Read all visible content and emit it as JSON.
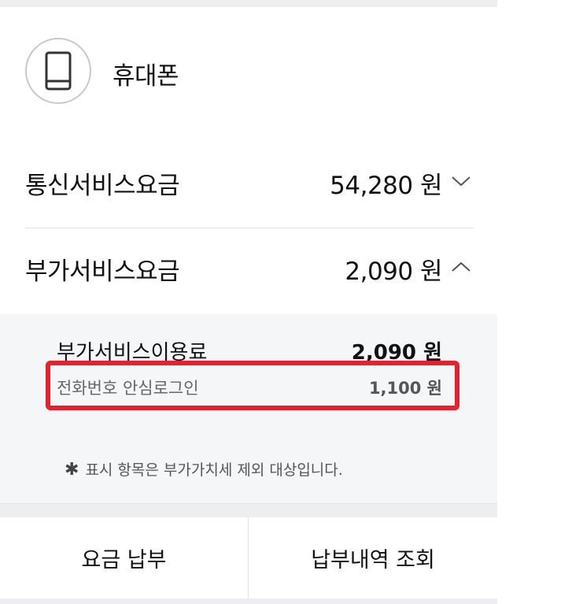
{
  "device": {
    "name": "휴대폰",
    "icon": "smartphone-icon"
  },
  "fees": [
    {
      "label": "통신서비스요금",
      "amount": "54,280 원",
      "state": "collapsed"
    },
    {
      "label": "부가서비스요금",
      "amount": "2,090 원",
      "state": "expanded"
    }
  ],
  "detail": {
    "header_label": "부가서비스이용료",
    "header_amount": "2,090 원",
    "items": [
      {
        "label": "전화번호 안심로그인",
        "amount": "1,100 원"
      }
    ],
    "note_mark": "✱",
    "note": "표시 항목은 부가가치세 제외 대상입니다."
  },
  "actions": {
    "pay_label": "요금 납부",
    "history_label": "납부내역 조회"
  },
  "colors": {
    "highlight": "#e8202e",
    "detail_bg": "#f5f6f8",
    "separator": "#eeeef0"
  }
}
